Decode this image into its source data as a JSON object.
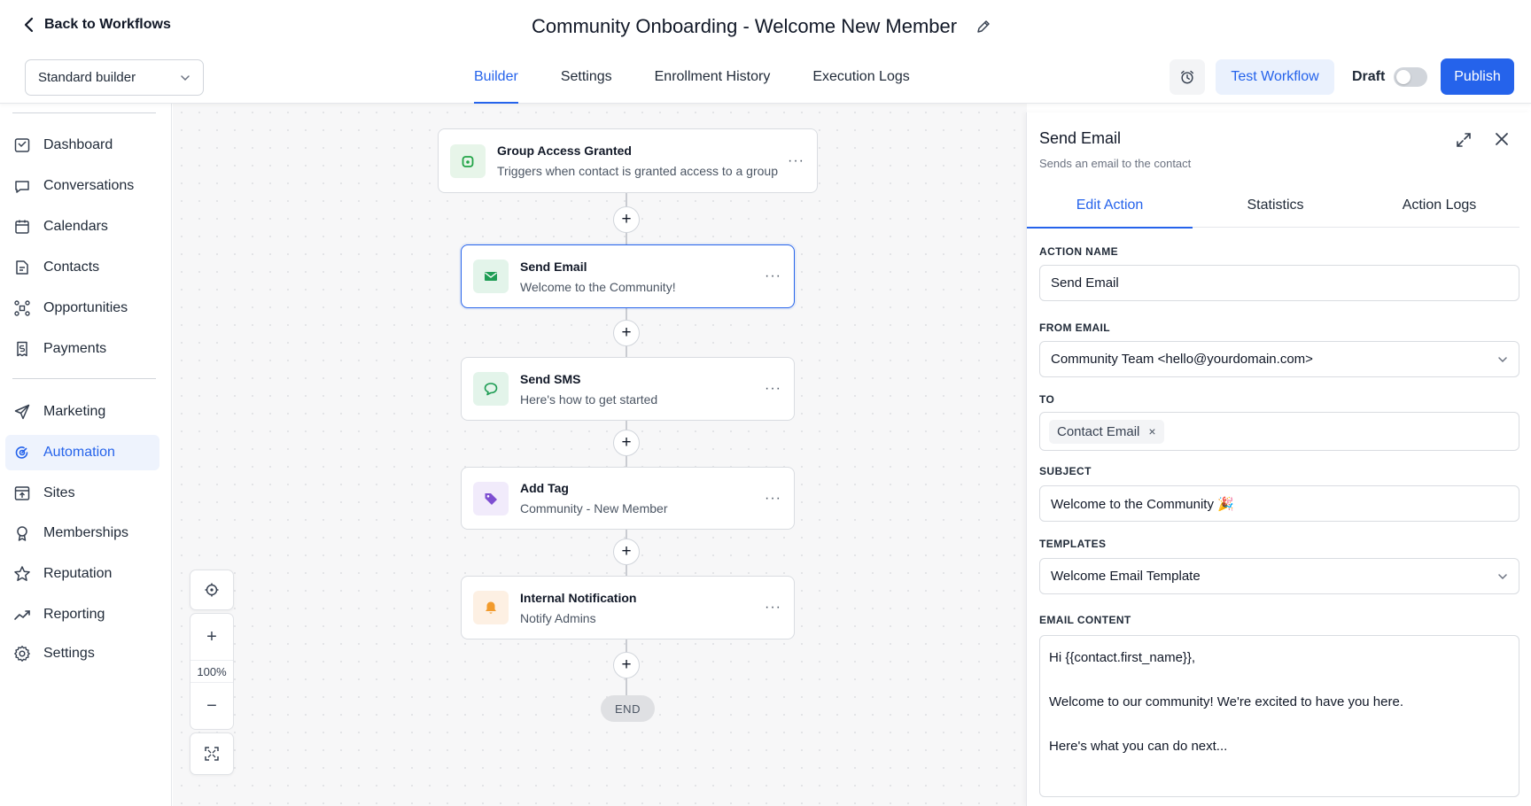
{
  "header": {
    "back_label": "Back to Workflows",
    "workflow_title": "Community Onboarding - Welcome New Member",
    "builder_select": "Standard builder",
    "tabs": [
      {
        "label": "Builder",
        "active": true
      },
      {
        "label": "Settings",
        "active": false
      },
      {
        "label": "Enrollment History",
        "active": false
      },
      {
        "label": "Execution Logs",
        "active": false
      }
    ],
    "test_label": "Test Workflow",
    "draft_label": "Draft",
    "draft_enabled": false,
    "publish_label": "Publish",
    "accent_color": "#2563eb"
  },
  "sidebar": {
    "items": [
      {
        "label": "Dashboard",
        "icon": "dashboard-icon"
      },
      {
        "label": "Conversations",
        "icon": "chat-icon"
      },
      {
        "label": "Calendars",
        "icon": "calendar-icon"
      },
      {
        "label": "Contacts",
        "icon": "contacts-icon"
      },
      {
        "label": "Opportunities",
        "icon": "opportunities-icon"
      },
      {
        "label": "Payments",
        "icon": "payments-icon"
      },
      {
        "label": "Marketing",
        "icon": "send-icon"
      },
      {
        "label": "Automation",
        "icon": "automation-icon",
        "active": true
      },
      {
        "label": "Sites",
        "icon": "sites-icon"
      },
      {
        "label": "Memberships",
        "icon": "memberships-icon"
      },
      {
        "label": "Reputation",
        "icon": "star-icon"
      },
      {
        "label": "Reporting",
        "icon": "reporting-icon"
      },
      {
        "label": "Settings",
        "icon": "gear-icon"
      }
    ]
  },
  "canvas": {
    "nodes": [
      {
        "title": "Group Access Granted",
        "subtitle": "Triggers when contact is granted access to a group",
        "icon": "lock-icon"
      },
      {
        "title": "Send Email",
        "subtitle": "Welcome to the Community!",
        "icon": "email-icon",
        "selected": true
      },
      {
        "title": "Send SMS",
        "subtitle": "Here's how to get started",
        "icon": "sms-icon"
      },
      {
        "title": "Add Tag",
        "subtitle": "Community - New Member",
        "icon": "tag-icon"
      },
      {
        "title": "Internal Notification",
        "subtitle": "Notify Admins",
        "icon": "bell-icon"
      }
    ],
    "more_label": "···",
    "plus_label": "+",
    "end_label": "END",
    "zoom_level": "100%",
    "zoom_in_label": "+",
    "zoom_out_label": "−"
  },
  "panel": {
    "title": "Send Email",
    "subtitle": "Sends an email to the contact",
    "tabs": [
      {
        "label": "Edit Action",
        "active": true
      },
      {
        "label": "Statistics",
        "active": false
      },
      {
        "label": "Action Logs",
        "active": false
      }
    ],
    "action_name_label": "ACTION NAME",
    "action_name_value": "Send Email",
    "from_email_label": "FROM EMAIL",
    "from_email_value": "Community Team <hello@yourdomain.com>",
    "to_label": "TO",
    "to_chip": "Contact Email",
    "to_chip_remove": "×",
    "subject_label": "SUBJECT",
    "subject_value": "Welcome to the Community 🎉",
    "templates_label": "TEMPLATES",
    "templates_value": "Welcome Email Template",
    "email_content_label": "EMAIL CONTENT",
    "email_content_lines": [
      "Hi {{contact.first_name}},",
      "Welcome to our community! We're excited to have you here.",
      "Here's what you can do next..."
    ]
  }
}
